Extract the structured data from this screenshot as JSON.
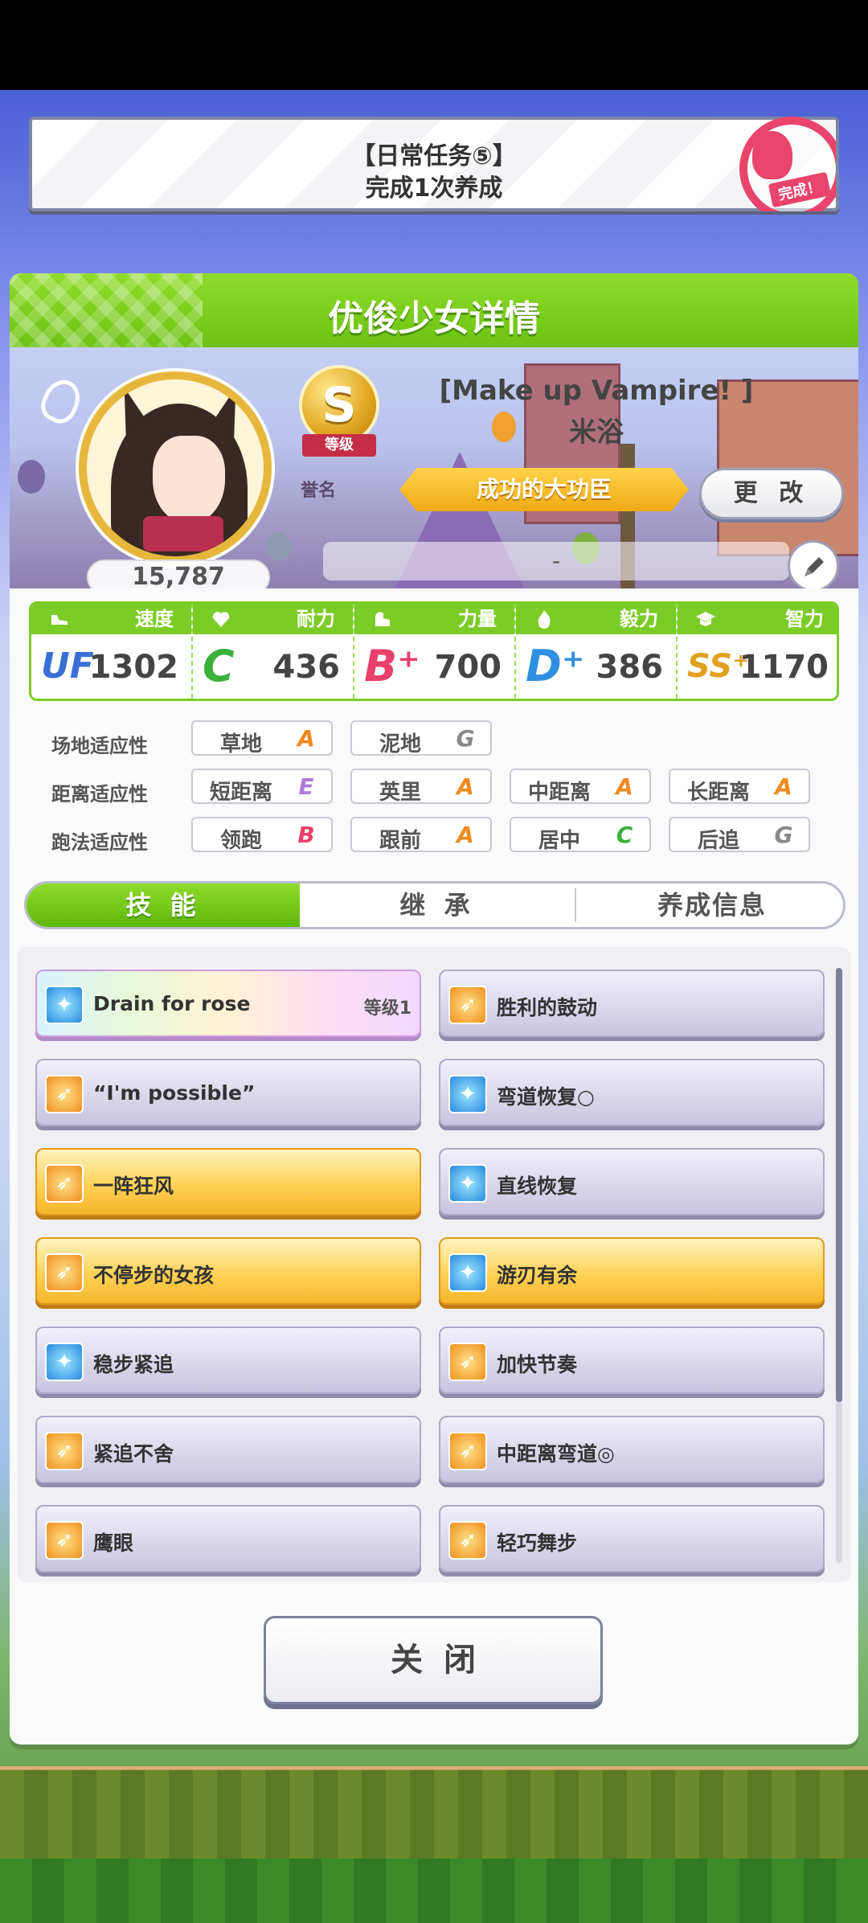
{
  "mission": {
    "title": "【日常任务⑤】",
    "subtitle": "完成1次养成",
    "stamp": "完成！"
  },
  "panel": {
    "title": "优俊少女详情"
  },
  "profile": {
    "fans": "15,787",
    "rank_letter": "S",
    "rank_label": "等级",
    "honor_label": "誉名",
    "outfit": "[Make up Vampire! ]",
    "name": "米浴",
    "title": "成功的大功臣",
    "change_label": "更 改",
    "comment": "-"
  },
  "stats": [
    {
      "label": "速度",
      "grade": "UF",
      "value": "1302",
      "color": "#3b6fd8"
    },
    {
      "label": "耐力",
      "grade": "C",
      "value": "436",
      "color": "#3bb03b"
    },
    {
      "label": "力量",
      "grade": "B⁺",
      "value": "700",
      "color": "#e8406a"
    },
    {
      "label": "毅力",
      "grade": "D⁺",
      "value": "386",
      "color": "#2f8fe0"
    },
    {
      "label": "智力",
      "grade": "SS⁺",
      "value": "1170",
      "color": "#e0a020"
    }
  ],
  "aptitude": {
    "track_label": "场地适应性",
    "distance_label": "距离适应性",
    "style_label": "跑法适应性",
    "track": [
      {
        "name": "草地",
        "grade": "A"
      },
      {
        "name": "泥地",
        "grade": "G"
      }
    ],
    "distance": [
      {
        "name": "短距离",
        "grade": "E"
      },
      {
        "name": "英里",
        "grade": "A"
      },
      {
        "name": "中距离",
        "grade": "A"
      },
      {
        "name": "长距离",
        "grade": "A"
      }
    ],
    "style": [
      {
        "name": "领跑",
        "grade": "B"
      },
      {
        "name": "跟前",
        "grade": "A"
      },
      {
        "name": "居中",
        "grade": "C"
      },
      {
        "name": "后追",
        "grade": "G"
      }
    ]
  },
  "tabs": [
    {
      "label": "技 能"
    },
    {
      "label": "继 承"
    },
    {
      "label": "养成信息"
    }
  ],
  "skills": [
    {
      "name": "Drain for rose",
      "level": "等级1",
      "icon": "blue"
    },
    {
      "name": "胜利的鼓动",
      "icon": "orange"
    },
    {
      "name": "“I'm possible”",
      "icon": "orange"
    },
    {
      "name": "弯道恢复○",
      "icon": "blue"
    },
    {
      "name": "一阵狂风",
      "icon": "orange"
    },
    {
      "name": "直线恢复",
      "icon": "blue"
    },
    {
      "name": "不停步的女孩",
      "icon": "orange"
    },
    {
      "name": "游刃有余",
      "icon": "blue"
    },
    {
      "name": "稳步紧追",
      "icon": "blue"
    },
    {
      "name": "加快节奏",
      "icon": "orange"
    },
    {
      "name": "紧追不舍",
      "icon": "orange"
    },
    {
      "name": "中距离弯道◎",
      "icon": "orange"
    },
    {
      "name": "鹰眼",
      "icon": "orange"
    },
    {
      "name": "轻巧舞步",
      "icon": "orange"
    }
  ],
  "close_label": "关闭",
  "colors": {
    "accent_green": "#7ccc27",
    "gold": "#f7b52b",
    "grade_a": "#f08a1e"
  }
}
